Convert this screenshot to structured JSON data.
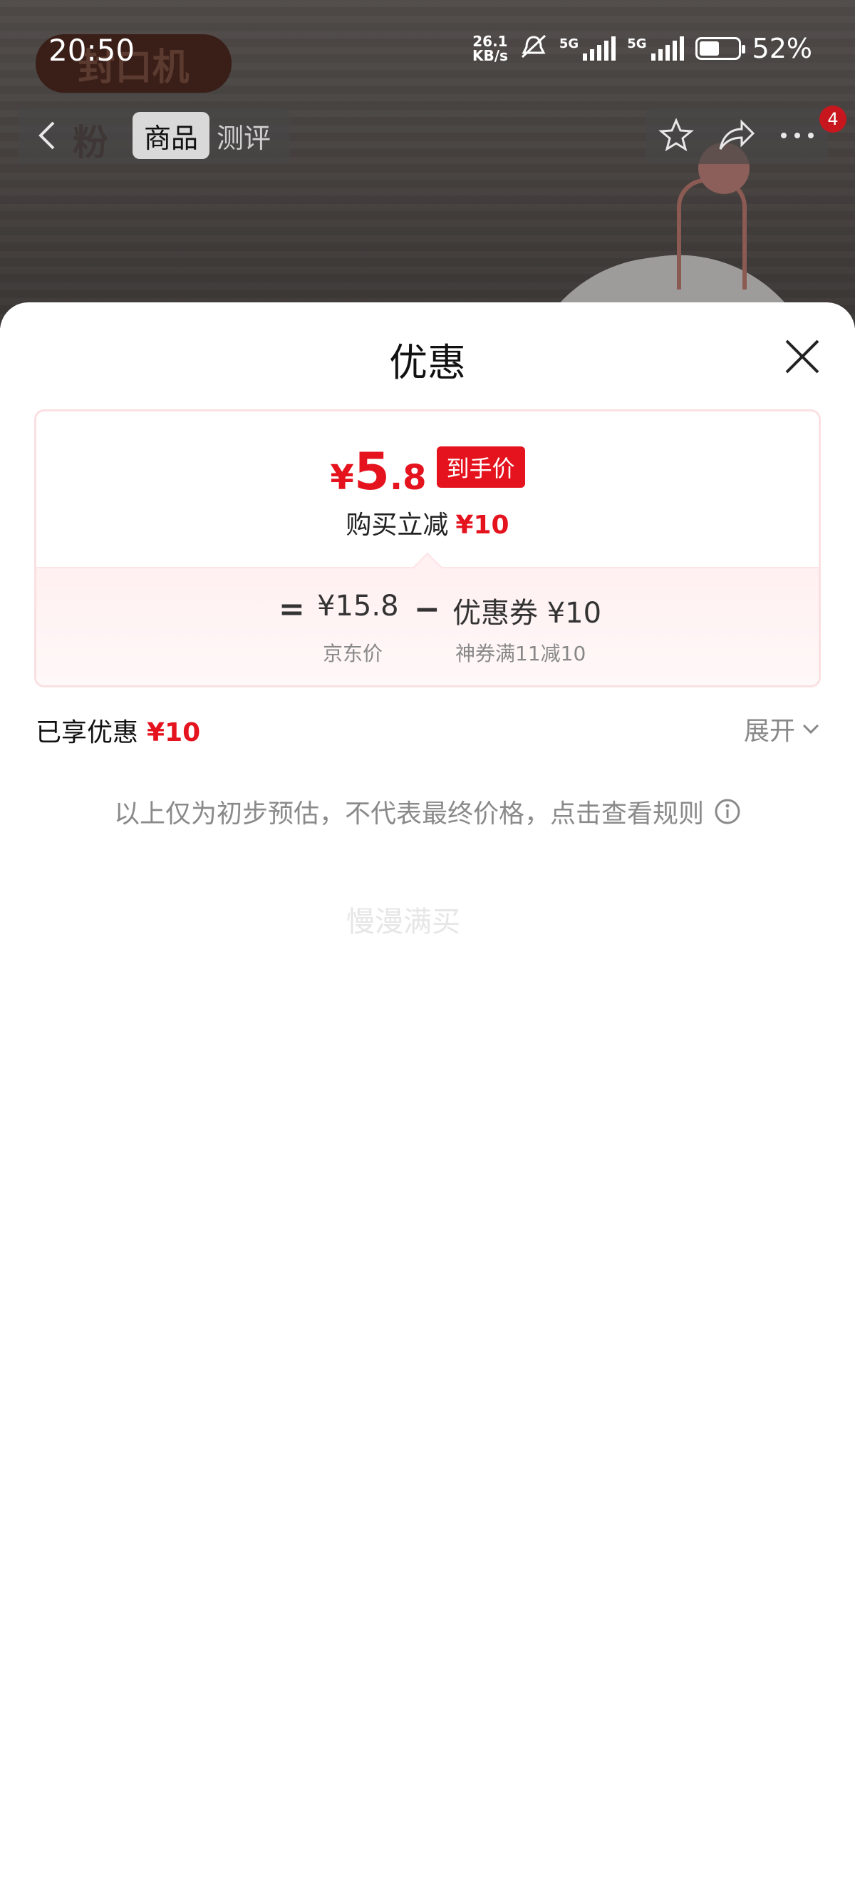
{
  "status_bar": {
    "time": "20:50",
    "net_speed_value": "26.1",
    "net_speed_unit": "KB/s",
    "sim1_label": "5G",
    "sim2_label": "5G",
    "battery_level": 52,
    "battery_text": "52%"
  },
  "background_page": {
    "banner_text": "封口机",
    "side_text": "粉",
    "nav": {
      "tabs": [
        {
          "label": "商品",
          "active": true
        },
        {
          "label": "测评",
          "active": false
        }
      ],
      "badge_count": "4",
      "icons": [
        "back-icon",
        "star-icon",
        "share-icon",
        "more-icon"
      ]
    }
  },
  "sheet": {
    "title": "优惠",
    "card": {
      "final_price_symbol": "¥",
      "final_price_int": "5",
      "final_price_dec": ".8",
      "final_price_tag": "到手价",
      "reduce_label": "购买立减",
      "reduce_value": "¥10",
      "calc": {
        "equals": "=",
        "base_price": "¥15.8",
        "base_label": "京东价",
        "minus": "−",
        "coupon": "优惠券 ¥10",
        "coupon_label": "神券满11减10"
      }
    },
    "enjoyed_label": "已享优惠",
    "enjoyed_value": "¥10",
    "expand_label": "展开",
    "rule_note": "以上仅为初步预估，不代表最终价格，点击查看规则",
    "watermark": "慢漫满买"
  },
  "colors": {
    "accent_red": "#e4131d",
    "text_dark": "#111111",
    "text_gray": "#888888"
  }
}
